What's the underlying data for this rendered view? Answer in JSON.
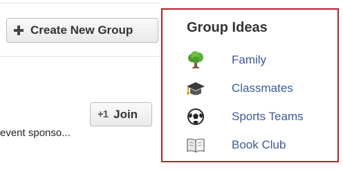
{
  "toolbar": {
    "create_label": "Create New Group",
    "join_label": "Join",
    "join_icon_text": "+1"
  },
  "feed": {
    "snippet": "event sponso..."
  },
  "group_ideas": {
    "title": "Group Ideas",
    "border_color": "#b3202a",
    "link_color": "#3b5998",
    "items": [
      {
        "label": "Family",
        "icon": "tree-icon"
      },
      {
        "label": "Classmates",
        "icon": "graduation-cap-icon"
      },
      {
        "label": "Sports Teams",
        "icon": "soccer-ball-icon"
      },
      {
        "label": "Book Club",
        "icon": "book-icon"
      }
    ]
  }
}
